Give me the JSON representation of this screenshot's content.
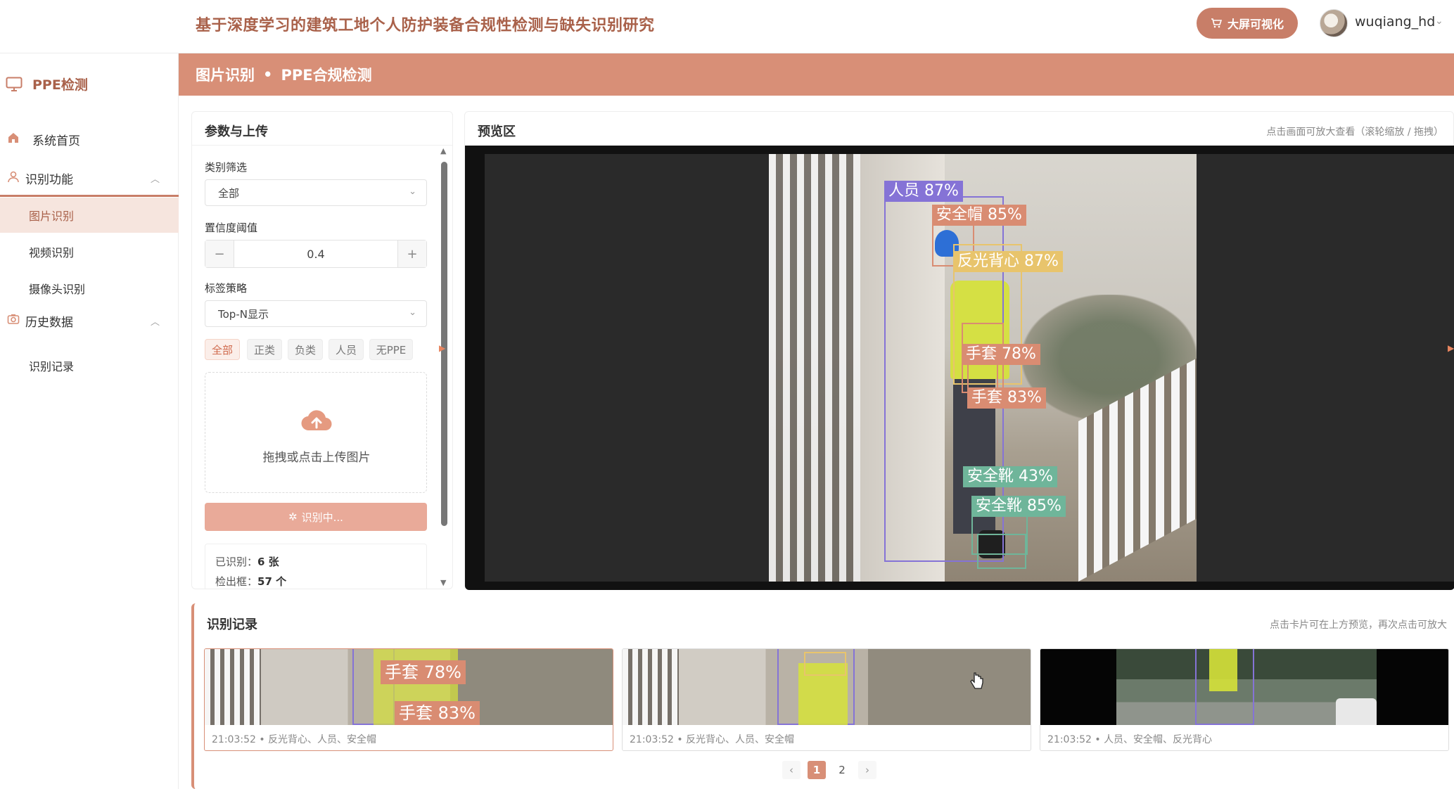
{
  "header": {
    "title": "基于深度学习的建筑工地个人防护装备合规性检测与缺失识别研究",
    "bigscreen_label": "大屏可视化",
    "username": "wuqiang_hd"
  },
  "sidebar": {
    "brand": "PPE检测",
    "home": "系统首页",
    "group_recognition": "识别功能",
    "items": [
      {
        "label": "图片识别"
      },
      {
        "label": "视频识别"
      },
      {
        "label": "摄像头识别"
      }
    ],
    "group_history": "历史数据",
    "history_items": [
      {
        "label": "识别记录"
      }
    ]
  },
  "breadcrumb": {
    "part1": "图片识别",
    "sep": "•",
    "part2": "PPE合规检测"
  },
  "params": {
    "title": "参数与上传",
    "category_label": "类别筛选",
    "category_value": "全部",
    "threshold_label": "置信度阈值",
    "threshold_value": "0.4",
    "minus": "−",
    "plus": "+",
    "strategy_label": "标签策略",
    "strategy_value": "Top-N显示",
    "chips": [
      "全部",
      "正类",
      "负类",
      "人员",
      "无PPE"
    ],
    "upload_text": "拖拽或点击上传图片",
    "recognize_label": "识别中...",
    "stat_recognized_label": "已识别：",
    "stat_recognized_value": "6 张",
    "stat_boxes_label": "检出框：",
    "stat_boxes_value": "57 个"
  },
  "preview": {
    "title": "预览区",
    "hint": "点击画面可放大查看（滚轮缩放 / 拖拽）",
    "detections": [
      {
        "label": "人员 87%",
        "color": "#8573d6"
      },
      {
        "label": "安全帽 85%",
        "color": "#d98c72"
      },
      {
        "label": "反光背心 87%",
        "color": "#e8c46c"
      },
      {
        "label": "手套 78%",
        "color": "#d98c72"
      },
      {
        "label": "手套 83%",
        "color": "#d98c72"
      },
      {
        "label": "安全靴 43%",
        "color": "#6fb59a"
      },
      {
        "label": "安全靴 85%",
        "color": "#6fb59a"
      }
    ]
  },
  "records": {
    "title": "识别记录",
    "hint": "点击卡片可在上方预览，再次点击可放大",
    "cards": [
      {
        "time": "21:03:52",
        "classes": "反光背心、人员、安全帽",
        "tag1": "手套 78%",
        "tag2": "手套 83%"
      },
      {
        "time": "21:03:52",
        "classes": "反光背心、人员、安全帽"
      },
      {
        "time": "21:03:52",
        "classes": "人员、安全帽、反光背心"
      }
    ],
    "dot": "•",
    "pager": {
      "prev": "‹",
      "pages": [
        "1",
        "2"
      ],
      "next": "›"
    }
  },
  "colors": {
    "accent": "#d88f77",
    "accent_dark": "#a9614a"
  }
}
